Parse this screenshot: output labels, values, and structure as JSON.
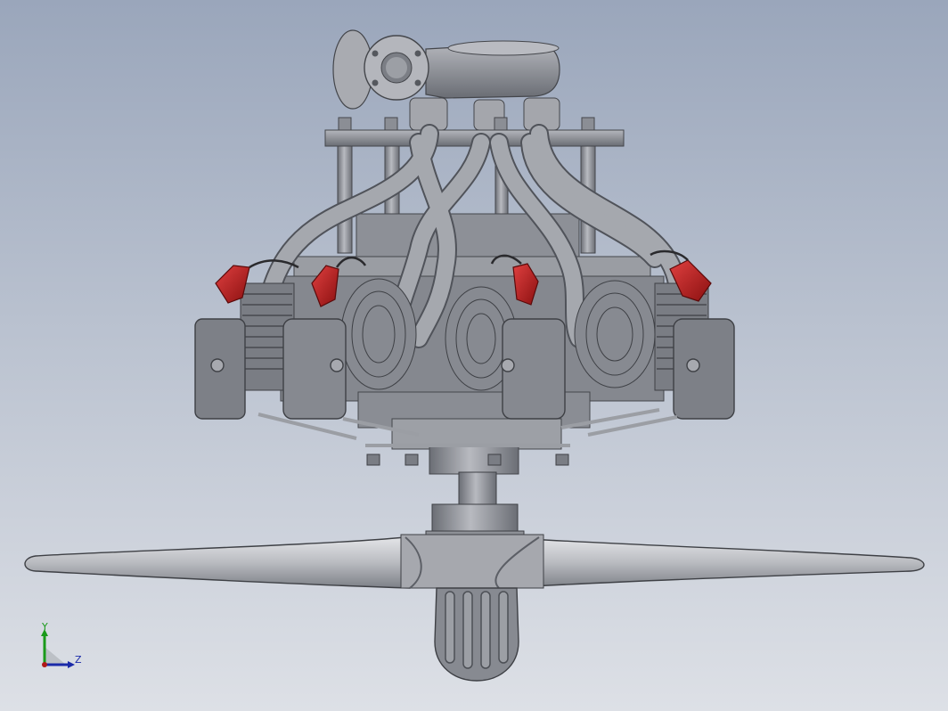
{
  "viewport": {
    "background_top": "#9aa6bb",
    "background_bottom": "#dde0e6"
  },
  "model": {
    "part_color": "#8f929b",
    "part_dark": "#5e6168",
    "part_light": "#c4c6cc",
    "spark_plug_cap_color": "#b01818",
    "icon": "radial-engine-model"
  },
  "triad": {
    "y_label": "Y",
    "z_label": "Z",
    "y_color": "#1a9a1a",
    "z_color": "#1a2aa8"
  }
}
